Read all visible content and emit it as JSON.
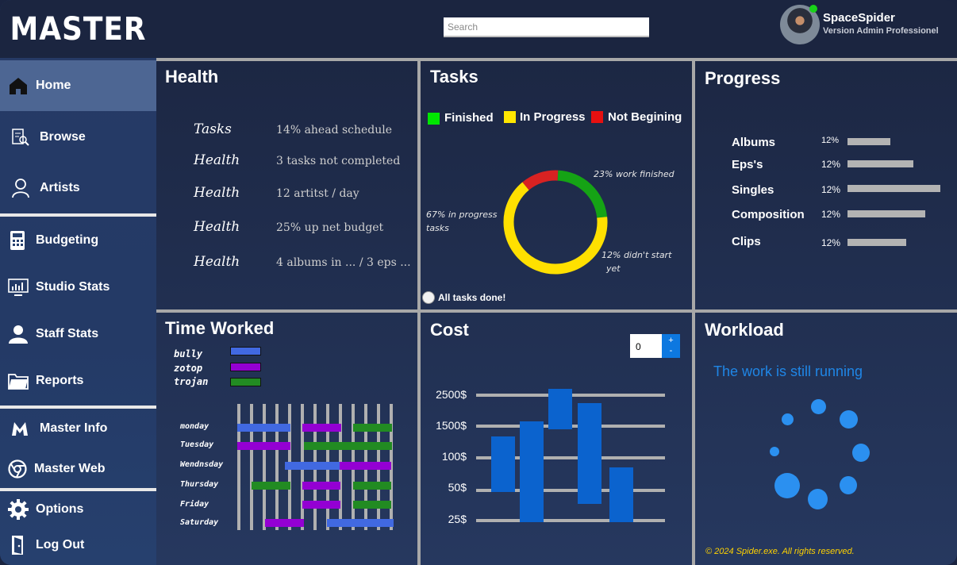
{
  "brand": {
    "logo_text": "MASTER"
  },
  "topbar": {
    "search_placeholder": "Search",
    "user": {
      "name": "SpaceSpider",
      "role": "Version Admin Professionel"
    }
  },
  "sidebar": {
    "items": [
      {
        "label": "Home",
        "icon": "home-icon",
        "active": true
      },
      {
        "label": "Browse",
        "icon": "browse-icon"
      },
      {
        "label": "Artists",
        "icon": "user-icon"
      },
      {
        "label": "Budgeting",
        "icon": "calculator-icon"
      },
      {
        "label": "Studio Stats",
        "icon": "monitor-chart-icon"
      },
      {
        "label": "Staff Stats",
        "icon": "person-icon"
      },
      {
        "label": "Reports",
        "icon": "folder-icon"
      },
      {
        "label": "Master Info",
        "icon": "m-logo-icon"
      },
      {
        "label": "Master Web",
        "icon": "chrome-icon"
      },
      {
        "label": "Options",
        "icon": "gear-icon"
      },
      {
        "label": "Log Out",
        "icon": "door-exit-icon"
      }
    ]
  },
  "health": {
    "title": "Health",
    "rows": [
      {
        "key": "Tasks",
        "value": "14%  ahead schedule"
      },
      {
        "key": "Health",
        "value": "3 tasks not completed"
      },
      {
        "key": "Health",
        "value": "12 artitst / day"
      },
      {
        "key": "Health",
        "value": "25% up net budget"
      },
      {
        "key": "Health",
        "value": "4 albums in ... / 3 eps ..."
      }
    ]
  },
  "tasks": {
    "title": "Tasks",
    "legend": [
      {
        "label": "Finished",
        "color": "#00e600"
      },
      {
        "label": "In Progress",
        "color": "#ffe600"
      },
      {
        "label": "Not Begining",
        "color": "#e61010"
      }
    ],
    "annotations": {
      "finished": "23% work finished",
      "progress_line1": "67% in progress",
      "progress_line2": "tasks",
      "notstart_line1": "12% didn't start",
      "notstart_line2": "yet"
    },
    "checkbox_label": "All tasks done!",
    "checkbox_checked": false
  },
  "chart_data": {
    "type": "pie",
    "style": "donut",
    "slices": [
      {
        "label": "Finished",
        "value": 23,
        "color": "#15a315"
      },
      {
        "label": "In Progress",
        "value": 67,
        "color": "#ffe000"
      },
      {
        "label": "Not Begining",
        "value": 12,
        "color": "#d82222"
      }
    ]
  },
  "progress": {
    "title": "Progress",
    "items": [
      {
        "label": "Albums",
        "pct": "12%",
        "fill": 0.46
      },
      {
        "label": "Eps's",
        "pct": "12%",
        "fill": 0.71
      },
      {
        "label": "Singles",
        "pct": "12%",
        "fill": 1.0
      },
      {
        "label": "Composition",
        "pct": "12%",
        "fill": 0.84
      },
      {
        "label": "Clips",
        "pct": "12%",
        "fill": 0.63
      }
    ]
  },
  "time_worked": {
    "title": "Time Worked",
    "legend": [
      {
        "label": "bully",
        "color": "#4169e1"
      },
      {
        "label": "zotop",
        "color": "#9400d3"
      },
      {
        "label": "trojan",
        "color": "#228b22"
      }
    ],
    "days": [
      "monday",
      "Tuesday",
      "Wendnsday",
      "Thursday",
      "Friday",
      "Saturday"
    ]
  },
  "cost": {
    "title": "Cost",
    "spinner_value": "0",
    "spinner_plus": "+",
    "spinner_minus": "-",
    "ticks": [
      "2500$",
      "1500$",
      "100$",
      "50$",
      "25$"
    ]
  },
  "workload": {
    "title": "Workload",
    "message": "The work is still running"
  },
  "footer": "© 2024 Spider.exe. All rights reserved."
}
